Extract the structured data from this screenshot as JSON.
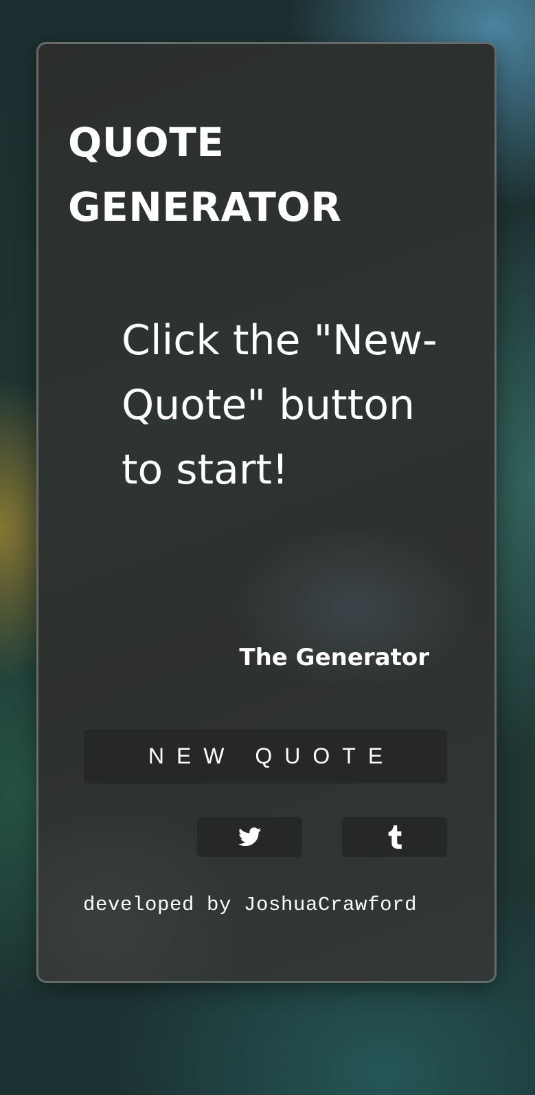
{
  "app": {
    "title": "QUOTE GENERATOR"
  },
  "quote": {
    "text": "Click the \"New-Quote\" button to start!",
    "author": "The Generator"
  },
  "buttons": {
    "new_quote_label": "NEW QUOTE",
    "twitter_icon": "twitter-bird-icon",
    "tumblr_icon": "tumblr-t-icon"
  },
  "footer": {
    "credit": "developed by JoshuaCrawford"
  },
  "colors": {
    "text": "#ffffff",
    "button_bg": "#262828",
    "card_border": "#7a7f7f"
  }
}
